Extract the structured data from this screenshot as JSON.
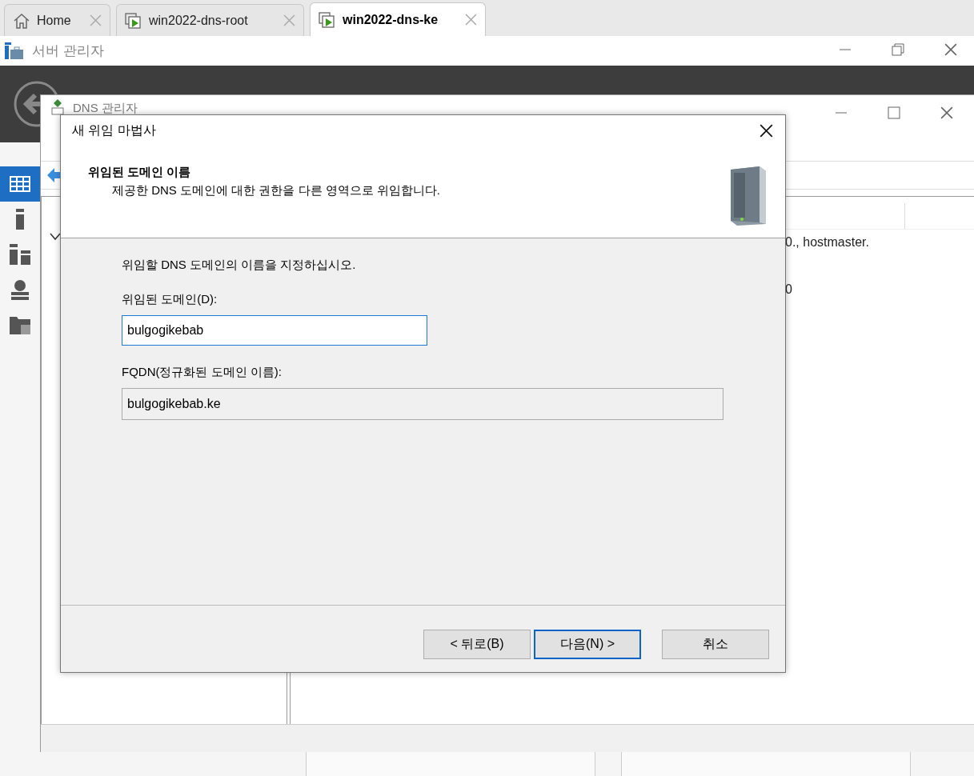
{
  "browser_tabs": [
    {
      "label": "Home",
      "kind": "home",
      "selected": false
    },
    {
      "label": "win2022-dns-root",
      "kind": "vm",
      "selected": false
    },
    {
      "label": "win2022-dns-ke",
      "kind": "vm",
      "selected": true
    }
  ],
  "server_manager": {
    "title": "서버 관리자"
  },
  "server_nav": [
    {
      "kind": "dashboard",
      "selected": true
    },
    {
      "kind": "local",
      "selected": false
    },
    {
      "kind": "all",
      "selected": false
    },
    {
      "kind": "dns",
      "selected": false
    },
    {
      "kind": "files",
      "selected": false
    }
  ],
  "dns_manager": {
    "title": "DNS 관리자",
    "details": [
      "0., hostmaster.",
      "0"
    ]
  },
  "wizard": {
    "title": "새 위임 마법사",
    "heading": "위임된 도메인 이름",
    "subheading": "제공한 DNS 도메인에 대한 권한을 다른 영역으로 위임합니다.",
    "prompt": "위임할 DNS 도메인의 이름을 지정하십시오.",
    "domain_label": "위임된 도메인(D):",
    "domain_value": "bulgogikebab",
    "fqdn_label": "FQDN(정규화된 도메인 이름):",
    "fqdn_value": "bulgogikebab.ke",
    "buttons": [
      {
        "label": "< 뒤로(B)",
        "default": false
      },
      {
        "label": "다음(N) >",
        "default": true
      },
      {
        "label": "취소",
        "default": false
      }
    ]
  }
}
